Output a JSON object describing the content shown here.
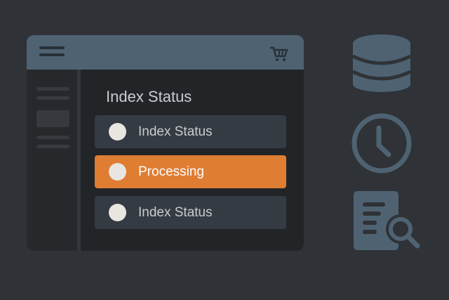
{
  "window": {
    "header": {
      "menu_icon": "hamburger-menu-icon",
      "cart_icon": "shopping-cart-icon"
    },
    "panel_title": "Index Status",
    "items": [
      {
        "label": "Index Status",
        "selected": false
      },
      {
        "label": "Processing",
        "selected": true
      },
      {
        "label": "Index Status",
        "selected": false
      }
    ]
  },
  "side_icons": [
    "database-icon",
    "clock-icon",
    "document-search-icon"
  ],
  "colors": {
    "background": "#2f3236",
    "window": "#222528",
    "header": "#4e6272",
    "accent": "#df7d33",
    "item": "#353b42",
    "icon": "#4e6272"
  }
}
